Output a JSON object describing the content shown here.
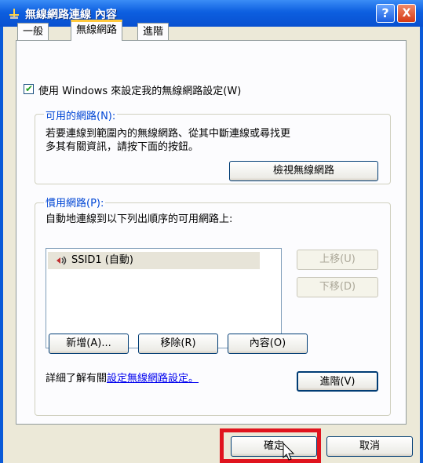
{
  "window": {
    "title": "無線網路連線 內容",
    "help_label": "?",
    "close_label": "X"
  },
  "tabs": [
    {
      "label": "一般",
      "active": false
    },
    {
      "label": "無線網路",
      "active": true
    },
    {
      "label": "進階",
      "active": false
    }
  ],
  "use_windows_checkbox": {
    "label": "使用 Windows 來設定我的無線網路設定(W)",
    "checked": true
  },
  "available_networks": {
    "group_label": "可用的網路(N):",
    "description_line1": "若要連線到範圍內的無線網路、從其中斷連線或尋找更",
    "description_line2": "多其有關資訊，請按下面的按鈕。",
    "view_button": "檢視無線網路"
  },
  "preferred_networks": {
    "group_label": "慣用網路(P):",
    "description": "自動地連線到以下列出順序的可用網路上:",
    "items": [
      {
        "label": "SSID1 (自動)",
        "icon": "wireless-network-icon"
      }
    ],
    "move_up_button": "上移(U)",
    "move_down_button": "下移(D)",
    "add_button": "新增(A)...",
    "remove_button": "移除(R)",
    "properties_button": "內容(O)"
  },
  "learn_more": {
    "prefix": "詳細了解有關",
    "link_text": "設定無線網路設定。",
    "advanced_button": "進階(V)"
  },
  "footer": {
    "ok_button": "確定",
    "cancel_button": "取消"
  },
  "colors": {
    "highlight_box": "#e0141e",
    "title_bar": "#0d5fe0",
    "dialog_bg": "#ece9d8"
  }
}
